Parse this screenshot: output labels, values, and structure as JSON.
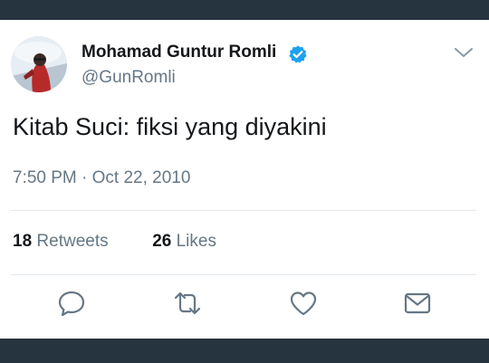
{
  "tweet": {
    "author": {
      "display_name": "Mohamad Guntur Romli",
      "handle": "@GunRomli",
      "verified": true
    },
    "text": "Kitab Suci: fiksi yang diyakini",
    "timestamp": "7:50 PM · Oct 22, 2010",
    "stats": {
      "retweets_count": "18",
      "retweets_label": "Retweets",
      "likes_count": "26",
      "likes_label": "Likes"
    },
    "actions": [
      "reply-icon",
      "retweet-icon",
      "like-icon",
      "share-icon"
    ]
  },
  "colors": {
    "frame": "#263440",
    "primary_text": "#14171a",
    "secondary_text": "#657786",
    "verified_blue": "#1da1f2",
    "divider": "#e1e8ed"
  }
}
